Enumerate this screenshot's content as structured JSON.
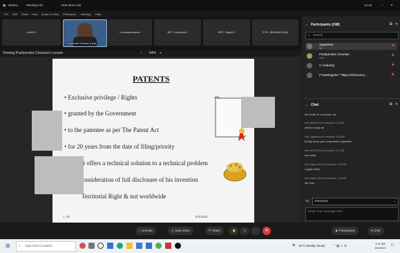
{
  "titlebar": {
    "items": [
      "Webex",
      "Meeting info",
      "Hide Menu bar"
    ],
    "time": "12:15"
  },
  "menubar": {
    "items": [
      "File",
      "Edit",
      "Share",
      "View",
      "Audio & Video",
      "Participant",
      "Meeting",
      "Help"
    ]
  },
  "video_strip": {
    "tiles": [
      "KaVil.K",
      "Pushpendra Chouhan (Host)",
      "c.amsaandanam",
      "BET- Monisha.K",
      "BET- Ragul K",
      "ETE- SHANMUGAM"
    ]
  },
  "share": {
    "viewing": "Viewing Pushpendra Chouhan's screen",
    "zoom": "64%"
  },
  "slide": {
    "title": "PATENTS",
    "bullets": [
      "Exclusive privilege / Rights",
      "granted by the Government",
      "to the patentee as per The Patent Act",
      "for 20 years from the date of filing/priority",
      "nt offers a technical solution to a technical problem",
      "consideration of full disclosure of his invention",
      "Territorial Right & not worldwide"
    ],
    "footer_page": "19",
    "footer_date": "8/4/2022"
  },
  "toolbar": {
    "unmute": "Unmute",
    "start_video": "Start video",
    "share": "Share",
    "participants": "Participants",
    "chat": "Chat"
  },
  "participants": {
    "header": "Participants (248)",
    "search_placeholder": "Search",
    "list": [
      {
        "name": "Jayashree",
        "sub": "Me"
      },
      {
        "name": "Pushpendra Chouhan",
        "sub": "Host"
      },
      {
        "name": "V. Gokulraj",
        "sub": ""
      },
      {
        "name": "{\"meetingURL\":\"https://chennai-p...",
        "sub": ""
      }
    ]
  },
  "chat": {
    "header": "Chat",
    "messages": [
      {
        "meta": "",
        "text": "dei Anish sir la trukaru da"
      },
      {
        "meta": "from AKASH G to everyone:  1:16 AM",
        "text": "alerta nunga da"
      },
      {
        "meta": "from Jayashree to everyone:  1:16 AM",
        "text": "Kindly keep your comments respectful"
      },
      {
        "meta": "from AKASH G to everyone:  1:17 AM",
        "text": "soy sister"
      },
      {
        "meta": "from Hyder Ali M to everyone:  1:19 AM",
        "text": "Logan bukki"
      },
      {
        "meta": "from Hyder Ali M to everyone:  1:19 AM",
        "text": "dei logu"
      }
    ],
    "to_label": "To:",
    "to_value": "Everyone",
    "input_placeholder": "Enter chat message here"
  },
  "taskbar": {
    "search_placeholder": "Type here to search",
    "weather": "32°C Mostly cloudy",
    "clock_time": "1:21 AM",
    "clock_date": "8/4/2022"
  },
  "colors": {
    "unmute_red": "#e0503c",
    "leave_red": "#e03c3c",
    "panel_bg": "#232323"
  }
}
